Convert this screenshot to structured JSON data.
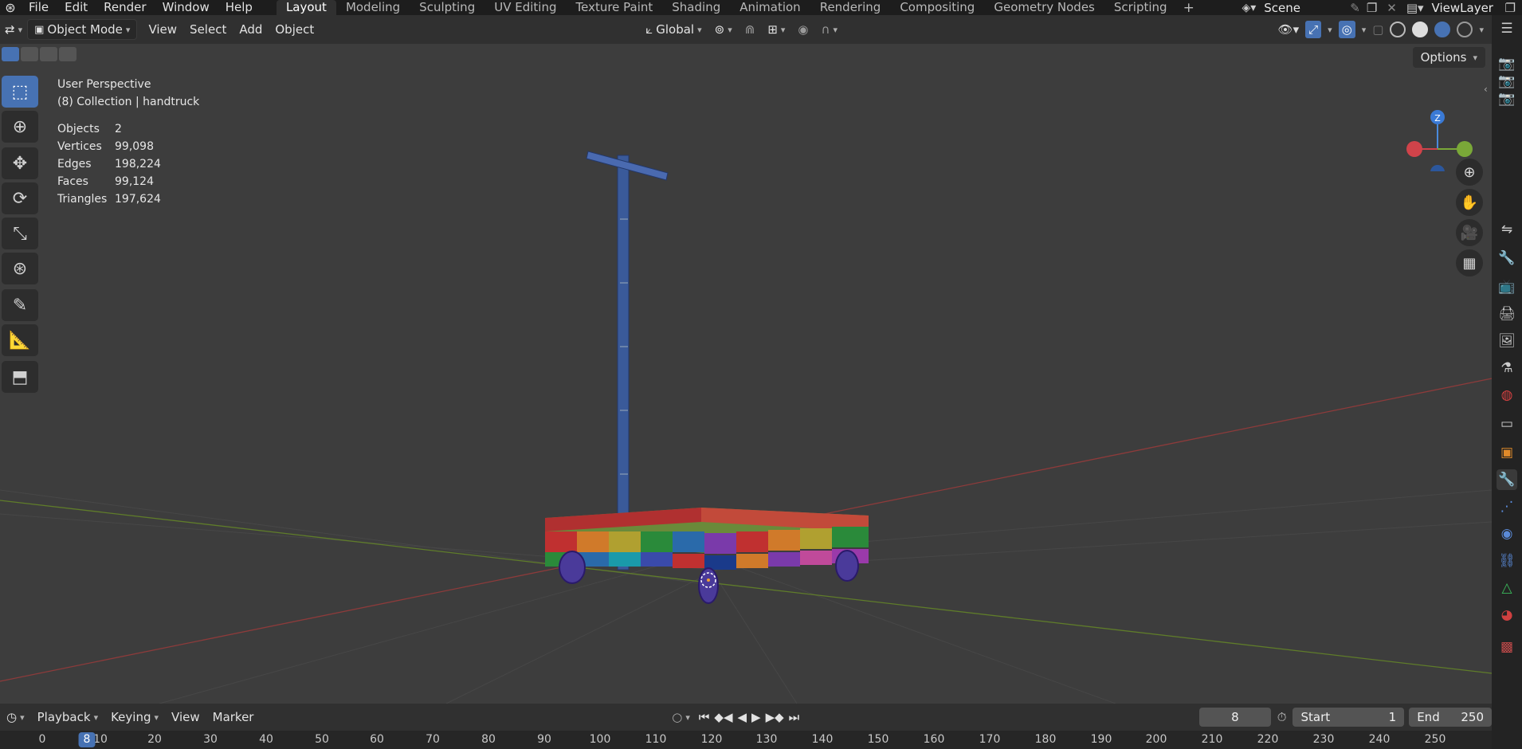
{
  "topbar": {
    "menus": [
      "File",
      "Edit",
      "Render",
      "Window",
      "Help"
    ],
    "workspaces": [
      "Layout",
      "Modeling",
      "Sculpting",
      "UV Editing",
      "Texture Paint",
      "Shading",
      "Animation",
      "Rendering",
      "Compositing",
      "Geometry Nodes",
      "Scripting"
    ],
    "active_workspace": "Layout",
    "scene": "Scene",
    "view_layer": "ViewLayer"
  },
  "header": {
    "mode": "Object Mode",
    "menus": [
      "View",
      "Select",
      "Add",
      "Object"
    ],
    "orientation": "Global"
  },
  "viewport": {
    "perspective": "User Perspective",
    "collection": "(8) Collection | handtruck",
    "stats": [
      {
        "label": "Objects",
        "value": "2"
      },
      {
        "label": "Vertices",
        "value": "99,098"
      },
      {
        "label": "Edges",
        "value": "198,224"
      },
      {
        "label": "Faces",
        "value": "99,124"
      },
      {
        "label": "Triangles",
        "value": "197,624"
      }
    ],
    "options_label": "Options",
    "gizmo_z": "Z"
  },
  "timeline": {
    "menus": [
      "Playback",
      "Keying",
      "View",
      "Marker"
    ],
    "current_frame": "8",
    "start_label": "Start",
    "start_value": "1",
    "end_label": "End",
    "end_value": "250",
    "ticks": [
      "0",
      "10",
      "20",
      "30",
      "40",
      "50",
      "60",
      "70",
      "80",
      "90",
      "100",
      "110",
      "120",
      "130",
      "140",
      "150",
      "160",
      "170",
      "180",
      "190",
      "200",
      "210",
      "220",
      "230",
      "240",
      "250"
    ],
    "marker": "8"
  },
  "colors": {
    "accent": "#4772b3",
    "viewport_bg": "#3d3d3d",
    "axis_x": "#a13a3a",
    "axis_y": "#6a8a2a"
  }
}
